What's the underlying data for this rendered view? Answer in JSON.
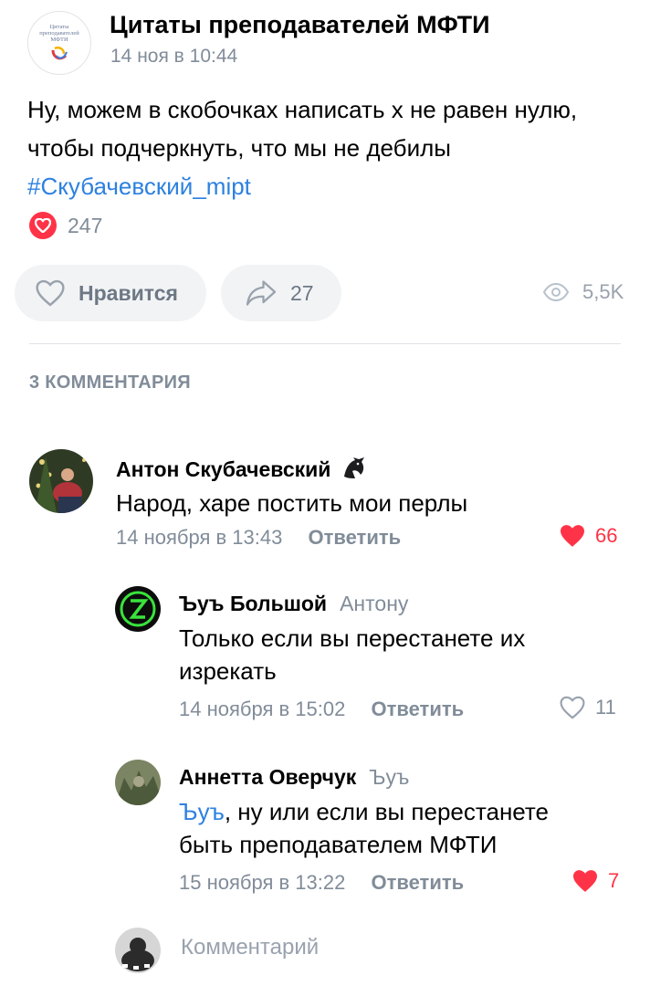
{
  "post": {
    "group_avatar_text": "Цитаты преподавателей МФТИ",
    "group_name": "Цитаты преподавателей МФТИ",
    "date": "14 ноя в 10:44",
    "text": "Ну, можем в скобочках написать х не равен нулю, чтобы подчеркнуть, что мы не дебилы",
    "hashtag": "#Скубачевский_mipt",
    "reactions_count": "247",
    "like_label": "Нравится",
    "shares_count": "27",
    "views_count": "5,5K"
  },
  "comments_header": "3 КОММЕНТАРИЯ",
  "comments": [
    {
      "author": "Антон Скубачевский",
      "text": "Народ, харе постить мои перлы",
      "date": "14 ноября в 13:43",
      "reply_label": "Ответить",
      "likes": "66",
      "liked": true
    },
    {
      "author": "Ъуъ Большой",
      "reply_to": "Антону",
      "text": "Только если вы перестанете их изрекать",
      "date": "14 ноября в 15:02",
      "reply_label": "Ответить",
      "likes": "11",
      "liked": false
    },
    {
      "author": "Аннетта Оверчук",
      "reply_to": "Ъуъ",
      "mention": "Ъуъ",
      "text": ", ну или если вы перестанете быть преподавателем МФТИ",
      "date": "15 ноября в 13:22",
      "reply_label": "Ответить",
      "likes": "7",
      "liked": true
    }
  ],
  "composer": {
    "placeholder": "Комментарий"
  },
  "colors": {
    "accent": "#2d81e0",
    "like_red": "#ff3347",
    "secondary_text": "#818c99",
    "pill_bg": "#f2f3f5"
  },
  "icons": {
    "reaction": "heart-icon",
    "like": "heart-outline-icon",
    "share": "share-arrow-icon",
    "views": "eye-icon",
    "verified": "dragon-icon"
  }
}
